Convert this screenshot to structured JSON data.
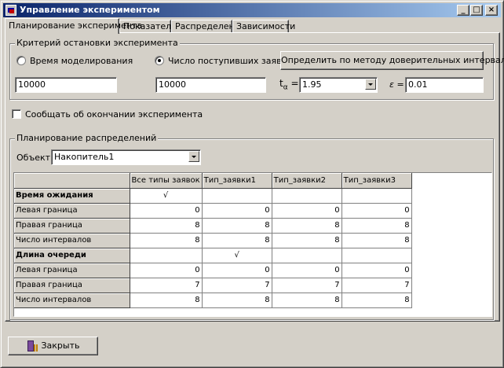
{
  "window": {
    "title": "Управление экспериментом",
    "minimize_glyph": "_",
    "maximize_glyph": "□",
    "close_glyph": "×"
  },
  "tabs": [
    {
      "label": "Планирование эксперимента",
      "active": true
    },
    {
      "label": "Показатели",
      "active": false
    },
    {
      "label": "Распределения",
      "active": false
    },
    {
      "label": "Зависимости",
      "active": false
    }
  ],
  "stop_criterion": {
    "group_label": "Критерий остановки эксперимента",
    "model_time_label": "Время моделирования",
    "model_time_selected": false,
    "arrivals_label": "Число поступивших заявок",
    "arrivals_selected": true,
    "confidence_button": "Определить по методу доверительных интервалов",
    "model_time_value": "10000",
    "arrivals_value": "10000",
    "t_alpha_label": "t",
    "t_alpha_sub": "α",
    "t_alpha_eq": "=",
    "t_alpha_value": "1.95",
    "epsilon_label": "ε =",
    "epsilon_value": "0.01"
  },
  "notify": {
    "label": "Сообщать об окончании эксперимента",
    "checked": false
  },
  "planning": {
    "group_label": "Планирование распределений",
    "object_label": "Объект",
    "object_value": "Накопитель1"
  },
  "grid": {
    "columns": [
      "",
      "Все типы заявок",
      "Тип_заявки1",
      "Тип_заявки2",
      "Тип_заявки3"
    ],
    "rows": [
      {
        "label": "Время ожидания",
        "section": true,
        "cells": [
          "√",
          "",
          "",
          ""
        ]
      },
      {
        "label": "Левая граница",
        "section": false,
        "cells": [
          "0",
          "0",
          "0",
          "0"
        ]
      },
      {
        "label": "Правая граница",
        "section": false,
        "cells": [
          "8",
          "8",
          "8",
          "8"
        ]
      },
      {
        "label": "Число интервалов",
        "section": false,
        "cells": [
          "8",
          "8",
          "8",
          "8"
        ]
      },
      {
        "label": "Длина очереди",
        "section": true,
        "cells": [
          "",
          "√",
          "",
          ""
        ]
      },
      {
        "label": "Левая граница",
        "section": false,
        "cells": [
          "0",
          "0",
          "0",
          "0"
        ]
      },
      {
        "label": "Правая граница",
        "section": false,
        "cells": [
          "7",
          "7",
          "7",
          "7"
        ]
      },
      {
        "label": "Число интервалов",
        "section": false,
        "cells": [
          "8",
          "8",
          "8",
          "8"
        ]
      }
    ]
  },
  "footer": {
    "close_button": "Закрыть"
  }
}
